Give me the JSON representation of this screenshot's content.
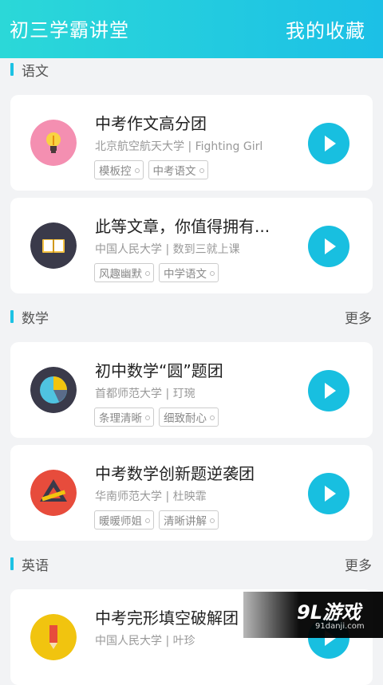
{
  "header": {
    "title": "初三学霸讲堂",
    "favorites_label": "我的收藏"
  },
  "sections": [
    {
      "name": "语文",
      "more": ""
    },
    {
      "name": "数学",
      "more": "更多"
    },
    {
      "name": "英语",
      "more": "更多"
    }
  ],
  "cards": [
    {
      "title": "中考作文高分团",
      "subtitle": "北京航空航天大学 | Fighting Girl",
      "tags": [
        "模板控",
        "中考语文"
      ],
      "icon": "lightbulb-icon",
      "color": "#f48fb1"
    },
    {
      "title": "此等文章，你值得拥有...",
      "subtitle": "中国人民大学 | 数到三就上课",
      "tags": [
        "风趣幽默",
        "中学语文"
      ],
      "icon": "book-icon",
      "color": "#3a3a4a"
    },
    {
      "title": "初中数学“圆”题团",
      "subtitle": "首都师范大学 | 玎琬",
      "tags": [
        "条理清晰",
        "细致耐心"
      ],
      "icon": "pie-chart-icon",
      "color": "#3a3a4a"
    },
    {
      "title": "中考数学创新题逆袭团",
      "subtitle": "华南师范大学 | 杜映霏",
      "tags": [
        "暖暖师姐",
        "清晰讲解"
      ],
      "icon": "triangle-ruler-icon",
      "color": "#e74c3c"
    },
    {
      "title": "中考完形填空破解团",
      "subtitle": "中国人民大学 | 叶珍",
      "tags": [],
      "icon": "pencil-icon",
      "color": "#f1c40f"
    }
  ],
  "watermark": {
    "main": "9L游戏",
    "sub": "91danji.com"
  }
}
